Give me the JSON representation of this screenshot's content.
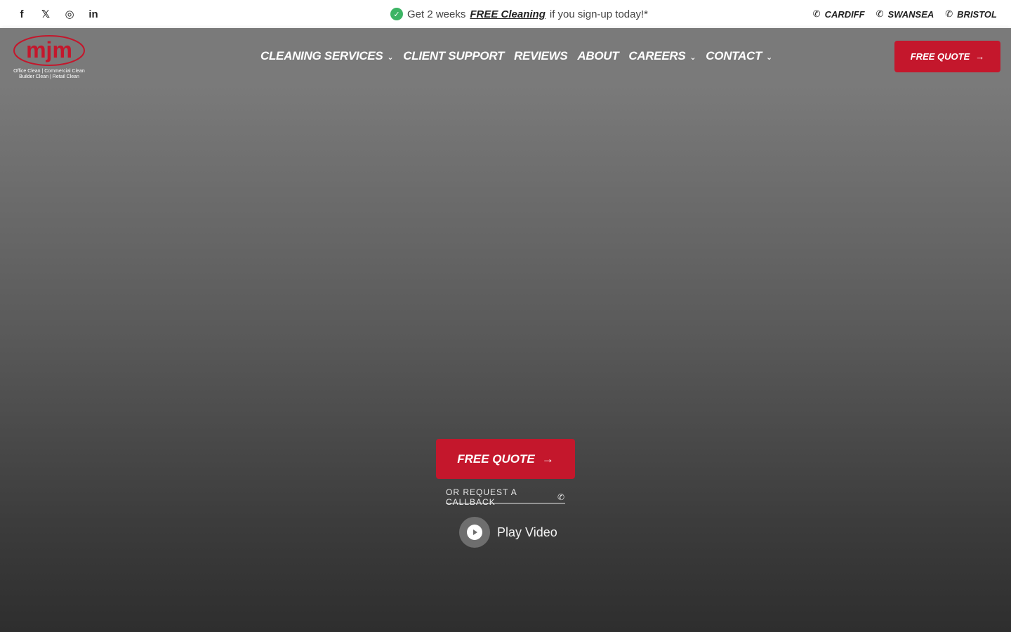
{
  "topbar": {
    "social": [
      {
        "name": "facebook-icon",
        "glyph": "f"
      },
      {
        "name": "x-icon",
        "glyph": "𝕏"
      },
      {
        "name": "instagram-icon",
        "glyph": "◎"
      },
      {
        "name": "linkedin-icon",
        "glyph": "in"
      }
    ],
    "promo": {
      "prefix": "Get 2 weeks",
      "highlight": "FREE Cleaning",
      "suffix": "if you sign-up today!*"
    },
    "phones": [
      "CARDIFF",
      "SWANSEA",
      "BRISTOL"
    ]
  },
  "header": {
    "logo": {
      "mark": "mjm",
      "line1": "Office Clean | Commercial Clean",
      "line2": "Builder Clean | Retail Clean"
    },
    "nav": [
      {
        "label": "CLEANING SERVICES",
        "dropdown": true
      },
      {
        "label": "CLIENT SUPPORT",
        "dropdown": false
      },
      {
        "label": "REVIEWS",
        "dropdown": false
      },
      {
        "label": "ABOUT",
        "dropdown": false
      },
      {
        "label": "CAREERS",
        "dropdown": true
      },
      {
        "label": "CONTACT",
        "dropdown": true
      }
    ],
    "cta_label": "FREE QUOTE"
  },
  "hero": {
    "cta_label": "FREE QUOTE",
    "callback_label": "OR REQUEST A CALLBACK",
    "play_label": "Play Video"
  },
  "colors": {
    "brand_red": "#c4172c",
    "check_green": "#3cb464"
  }
}
